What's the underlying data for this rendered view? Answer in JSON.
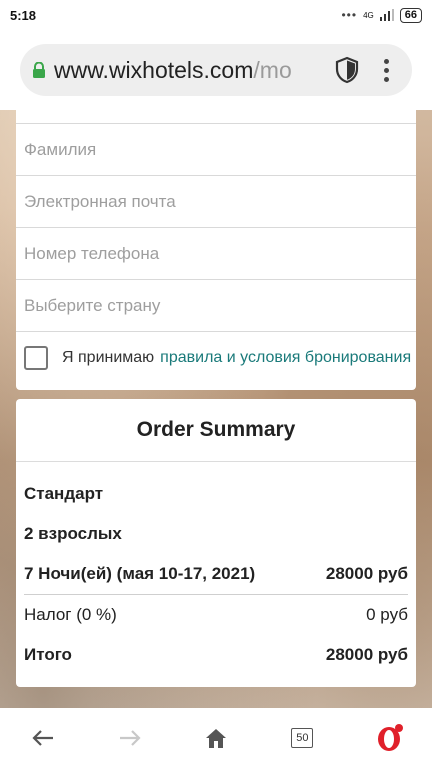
{
  "status_bar": {
    "time": "5:18",
    "network": "4G",
    "battery": "66",
    "dots": "•••"
  },
  "browser": {
    "url_main": "www.wixhotels.com",
    "url_rest": "/mo"
  },
  "form": {
    "fields": [
      {
        "placeholder": "Фамилия"
      },
      {
        "placeholder": "Электронная почта"
      },
      {
        "placeholder": "Номер телефона"
      },
      {
        "placeholder": "Выберите страну"
      }
    ],
    "terms_prefix": "Я принимаю",
    "terms_link": "правила и условия бронирования"
  },
  "summary": {
    "title": "Order Summary",
    "room": "Стандарт",
    "guests": "2 взрослых",
    "stay_label": "7 Ночи(ей) (мая 10-17, 2021)",
    "stay_price": "28000 руб",
    "tax_label": "Налог (0 %)",
    "tax_value": "0 руб",
    "total_label": "Итого",
    "total_value": "28000 руб"
  },
  "bottom_nav": {
    "tabs_count": "50"
  },
  "colors": {
    "link": "#1a7a7a",
    "opera_red": "#e0202a"
  }
}
